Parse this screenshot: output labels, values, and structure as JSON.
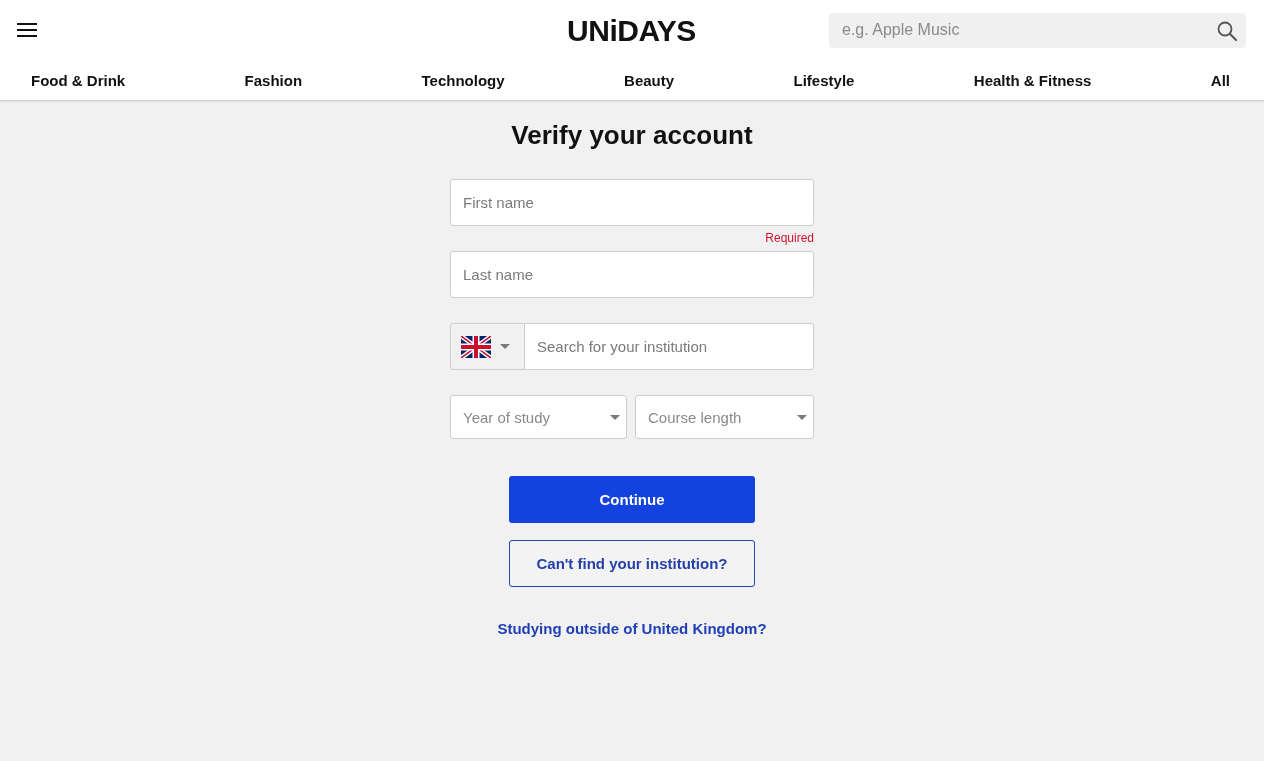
{
  "header": {
    "logo": "UNiDAYS",
    "search": {
      "placeholder": "e.g. Apple Music"
    },
    "nav": [
      {
        "label": "Food & Drink"
      },
      {
        "label": "Fashion"
      },
      {
        "label": "Technology"
      },
      {
        "label": "Beauty"
      },
      {
        "label": "Lifestyle"
      },
      {
        "label": "Health & Fitness"
      },
      {
        "label": "All"
      }
    ]
  },
  "form": {
    "title": "Verify your account",
    "first_name": {
      "placeholder": "First name",
      "error": "Required"
    },
    "last_name": {
      "placeholder": "Last name"
    },
    "institution": {
      "placeholder": "Search for your institution"
    },
    "year_of_study": {
      "placeholder": "Year of study"
    },
    "course_length": {
      "placeholder": "Course length"
    },
    "buttons": [
      {
        "kind": "primary",
        "label": "Continue"
      },
      {
        "kind": "outline",
        "label": "Can't find your institution?"
      }
    ],
    "link": "Studying outside of United Kingdom?"
  }
}
